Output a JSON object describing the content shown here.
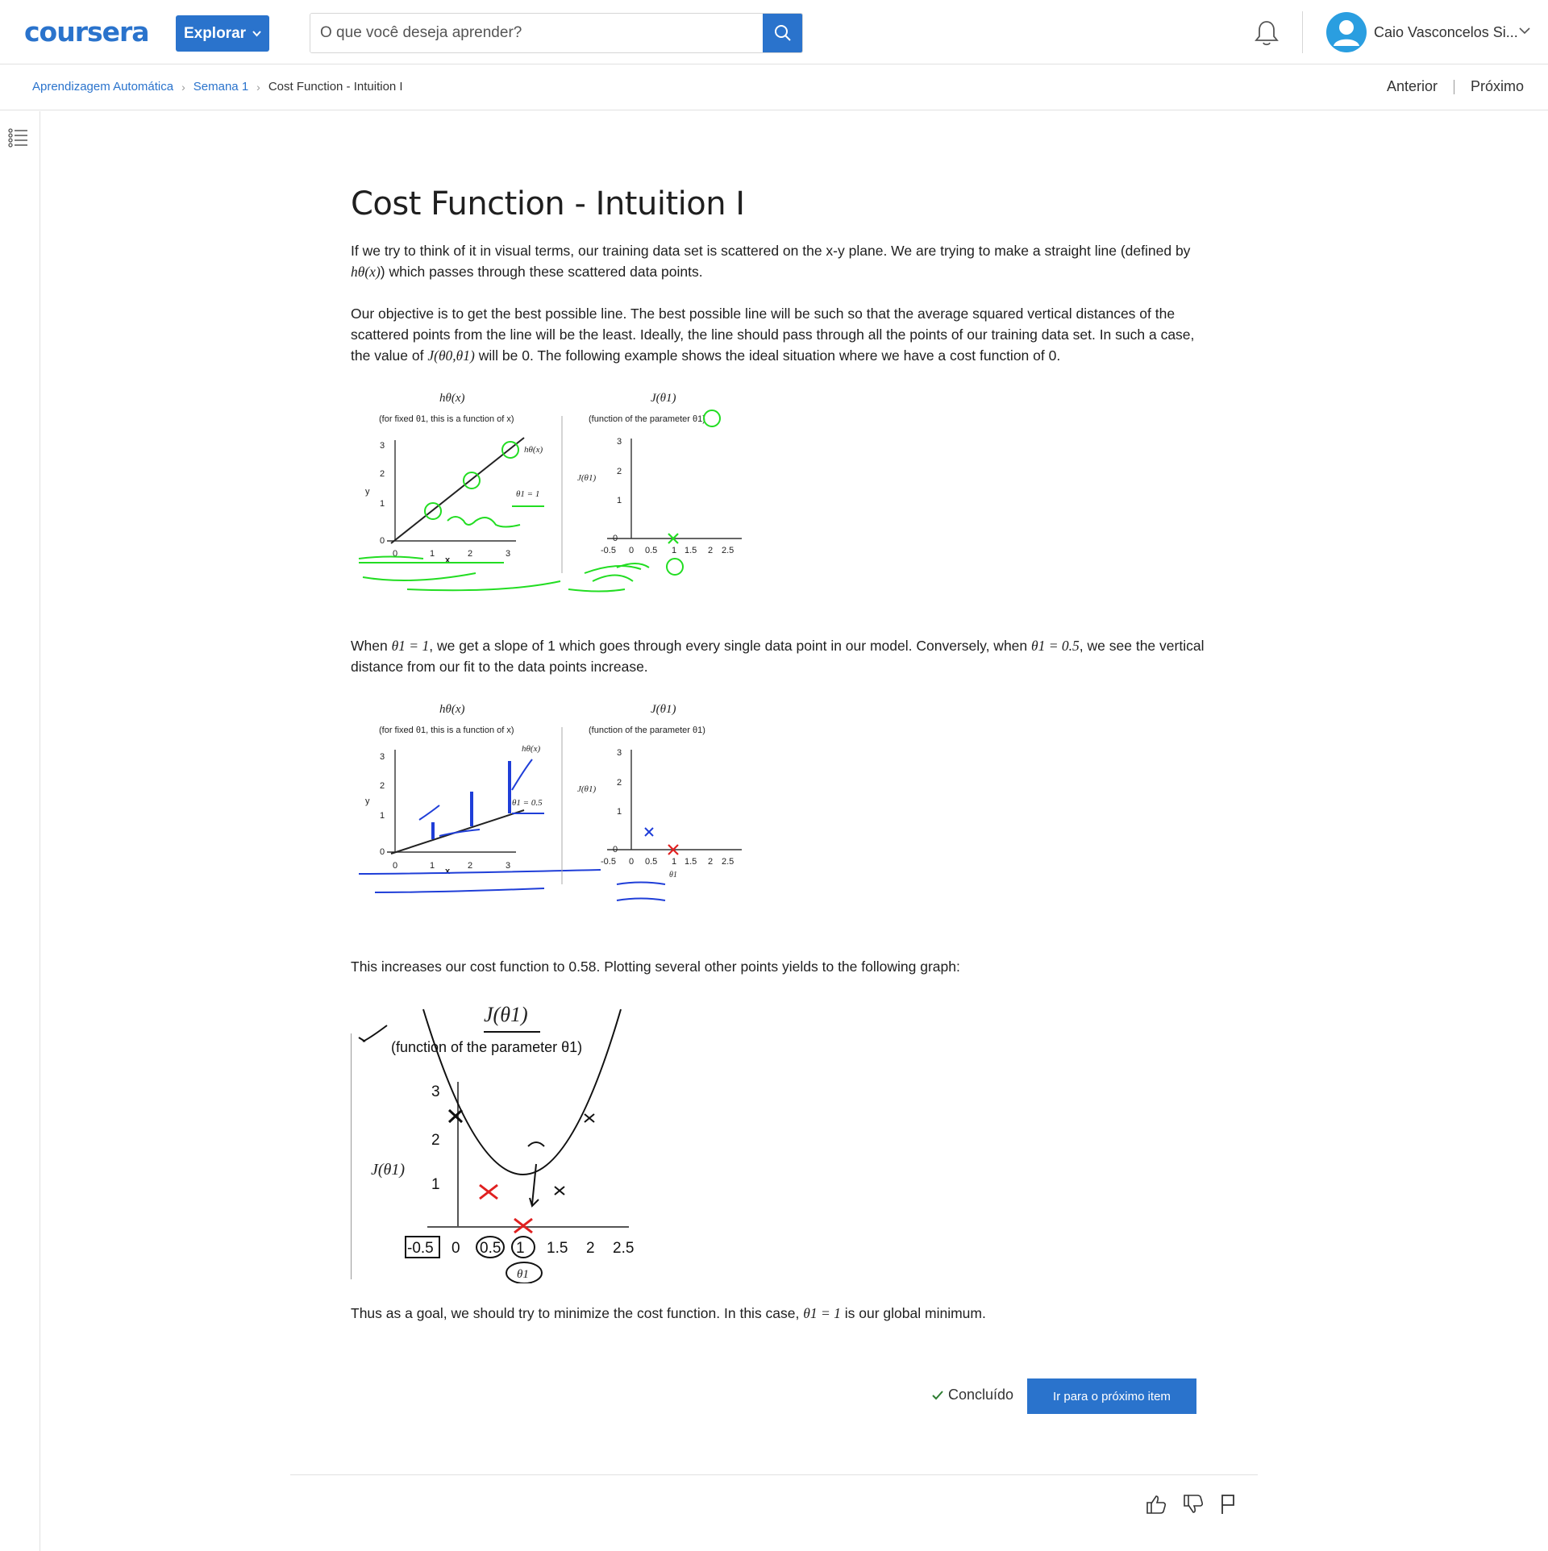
{
  "header": {
    "logo_text": "coursera",
    "explore_label": "Explorar",
    "search_placeholder": "O que você deseja aprender?",
    "user_name": "Caio Vasconcelos Si..."
  },
  "breadcrumb": {
    "items": [
      "Aprendizagem Automática",
      "Semana 1",
      "Cost Function - Intuition I"
    ]
  },
  "nav": {
    "prev": "Anterior",
    "next": "Próximo"
  },
  "article": {
    "title": "Cost Function - Intuition I",
    "p1_a": "If we try to think of it in visual terms, our training data set is scattered on the x-y plane. We are trying to make a straight line (defined by ",
    "p1_math": "hθ(x)",
    "p1_b": ") which passes through these scattered data points.",
    "p2_a": "Our objective is to get the best possible line. The best possible line will be such so that the average squared vertical distances of the scattered points from the line will be the least. Ideally, the line should pass through all the points of our training data set. In such a case, the value of ",
    "p2_math": "J(θ0,θ1)",
    "p2_b": " will be 0. The following example shows the ideal situation where we have a cost function of 0.",
    "p3_a": "When ",
    "p3_m1": "θ1 = 1",
    "p3_b": ", we get a slope of 1 which goes through every single data point in our model. Conversely, when ",
    "p3_m2": "θ1 = 0.5",
    "p3_c": ", we see the vertical distance from our fit to the data points increase.",
    "p4": "This increases our cost function to 0.58. Plotting several other points yields to the following graph:",
    "p5_a": "Thus as a goal, we should try to minimize the cost function. In this case, ",
    "p5_math": "θ1 = 1",
    "p5_b": " is our global minimum."
  },
  "figure1": {
    "left_title": "hθ(x)",
    "left_caption": "(for fixed θ1, this is a function of x)",
    "right_title": "J(θ1)",
    "right_caption": "(function of the parameter θ1)",
    "left_xticks": [
      "0",
      "1",
      "2",
      "3"
    ],
    "left_yticks": [
      "0",
      "1",
      "2",
      "3"
    ],
    "right_xticks": [
      "-0.5",
      "0",
      "0.5",
      "1",
      "1.5",
      "2",
      "2.5"
    ],
    "right_yticks": [
      "0",
      "1",
      "2",
      "3"
    ],
    "y_label": "y",
    "x_label": "x",
    "j_label": "J(θ1)",
    "theta_label": "θ1 = 1",
    "hx_label": "hθ(x)"
  },
  "figure2": {
    "left_title": "hθ(x)",
    "left_caption": "(for fixed θ1, this is a function of x)",
    "right_title": "J(θ1)",
    "right_caption": "(function of the parameter θ1)",
    "left_xticks": [
      "0",
      "1",
      "2",
      "3"
    ],
    "left_yticks": [
      "0",
      "1",
      "2",
      "3"
    ],
    "right_xticks": [
      "-0.5",
      "0",
      "0.5",
      "1",
      "1.5",
      "2",
      "2.5"
    ],
    "right_yticks": [
      "0",
      "1",
      "2",
      "3"
    ],
    "y_label": "y",
    "x_label": "x",
    "j_label": "J(θ1)",
    "theta_label": "θ1 = 0.5",
    "hx_label": "hθ(x)",
    "theta_axis": "θ1"
  },
  "figure3": {
    "title": "J(θ1)",
    "caption": "(function of the parameter θ1)",
    "xticks": [
      "-0.5",
      "0",
      "0.5",
      "1",
      "1.5",
      "2",
      "2.5"
    ],
    "yticks": [
      "1",
      "2",
      "3"
    ],
    "j_label": "J(θ1)",
    "theta_axis": "θ1"
  },
  "actions": {
    "done_label": "Concluído",
    "next_item_label": "Ir para o próximo item"
  },
  "colors": {
    "accent": "#2a73cc",
    "handwriting_green": "#22dd22",
    "handwriting_blue": "#1f3ed8",
    "marker_red": "#e02020"
  }
}
